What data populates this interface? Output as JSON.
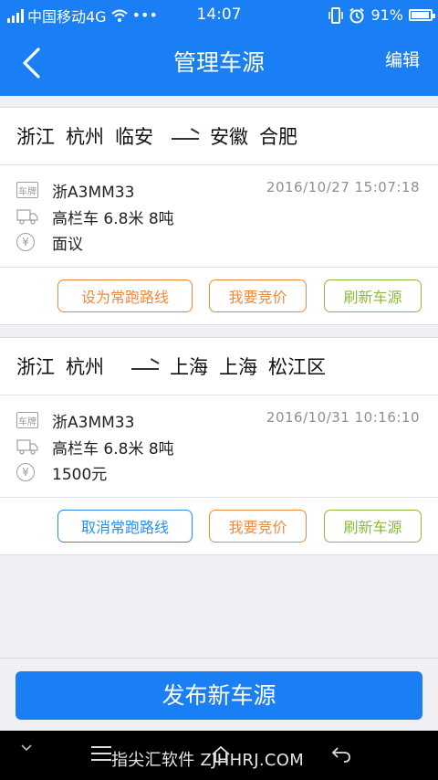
{
  "status_bar": {
    "carrier": "中国移动4G",
    "more": "•••",
    "time": "14:07",
    "battery": "91%"
  },
  "header": {
    "title": "管理车源",
    "edit_label": "编辑"
  },
  "cards": [
    {
      "origin": [
        "浙江",
        "杭州",
        "临安"
      ],
      "destination": [
        "安徽",
        "合肥"
      ],
      "plate": "浙A3MM33",
      "datetime": "2016/10/27   15:07:18",
      "vehicle": "高栏车  6.8米  8吨",
      "price": "面议",
      "buttons": {
        "route_toggle": "设为常跑路线",
        "bid": "我要竞价",
        "refresh": "刷新车源"
      }
    },
    {
      "origin": [
        "浙江",
        "杭州"
      ],
      "destination": [
        "上海",
        "上海",
        "松江区"
      ],
      "plate": "浙A3MM33",
      "datetime": "2016/10/31   10:16:10",
      "vehicle": "高栏车  6.8米  8吨",
      "price": "1500元",
      "buttons": {
        "route_toggle": "取消常跑路线",
        "bid": "我要竞价",
        "refresh": "刷新车源"
      }
    }
  ],
  "icons": {
    "plate_icon_text": "车牌",
    "yuan_icon_text": "¥"
  },
  "publish_label": "发布新车源",
  "system_bar": {
    "watermark": "指尖汇软件 ZJHHRJ.COM"
  },
  "colors": {
    "primary": "#1a7ef5",
    "orange": "#f08a3a",
    "green": "#8cba3c",
    "blue_outline": "#2c8de9"
  }
}
